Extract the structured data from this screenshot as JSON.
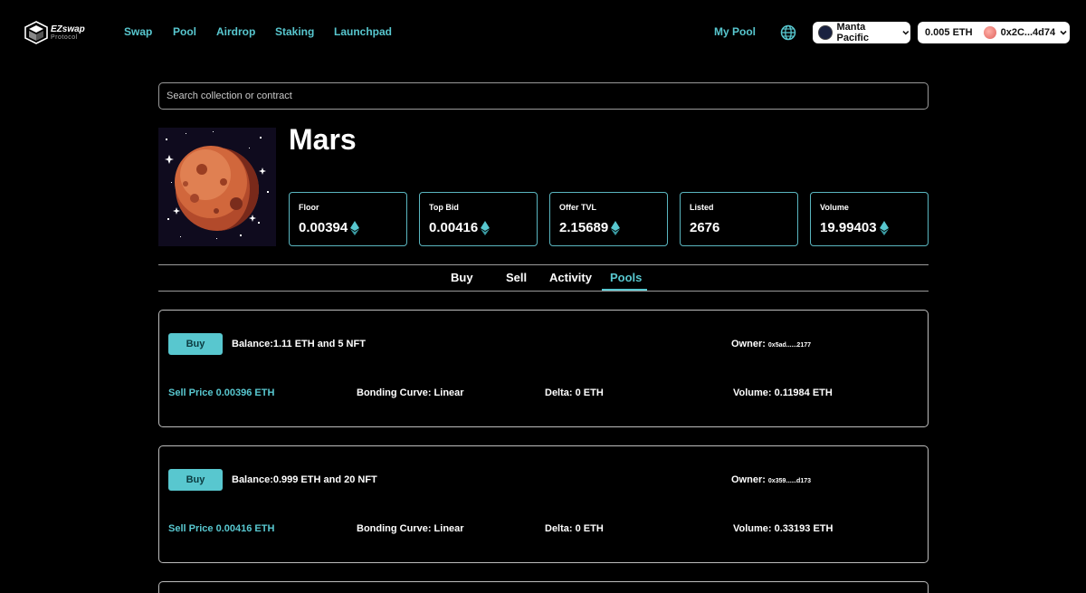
{
  "brand": {
    "name": "EZswap",
    "sub": "Protocol"
  },
  "nav": {
    "links": [
      "Swap",
      "Pool",
      "Airdrop",
      "Staking",
      "Launchpad"
    ],
    "my_pool": "My Pool",
    "chain": "Manta Pacific",
    "balance": "0.005 ETH",
    "address": "0x2C...4d74"
  },
  "search": {
    "placeholder": "Search collection or contract"
  },
  "collection": {
    "title": "Mars",
    "stats": [
      {
        "label": "Floor",
        "value": "0.00394",
        "icon": "eth-icon"
      },
      {
        "label": "Top Bid",
        "value": "0.00416",
        "icon": "eth-icon"
      },
      {
        "label": "Offer TVL",
        "value": "2.15689",
        "icon": "eth-icon"
      },
      {
        "label": "Listed",
        "value": "2676"
      },
      {
        "label": "Volume",
        "value": "19.99403",
        "icon": "eth-icon"
      }
    ]
  },
  "tabs": {
    "items": [
      "Buy",
      "Sell",
      "Activity",
      "Pools"
    ],
    "active": "Pools"
  },
  "pools": [
    {
      "button": "Buy",
      "balance": "Balance:1.11 ETH  and 5 NFT",
      "owner_label": "Owner:",
      "owner": "0x5ad......2177",
      "sell_price": "Sell Price 0.00396 ETH",
      "curve": "Bonding Curve: Linear",
      "delta": "Delta: 0 ETH",
      "volume": "Volume: 0.11984 ETH"
    },
    {
      "button": "Buy",
      "balance": "Balance:0.999 ETH  and 20 NFT",
      "owner_label": "Owner:",
      "owner": "0x359......d173",
      "sell_price": "Sell Price 0.00416 ETH",
      "curve": "Bonding Curve: Linear",
      "delta": "Delta: 0 ETH",
      "volume": "Volume: 0.33193 ETH"
    }
  ],
  "colors": {
    "accent": "#58c7cf",
    "background": "#000000",
    "stat_border": "#5ab6c0"
  }
}
